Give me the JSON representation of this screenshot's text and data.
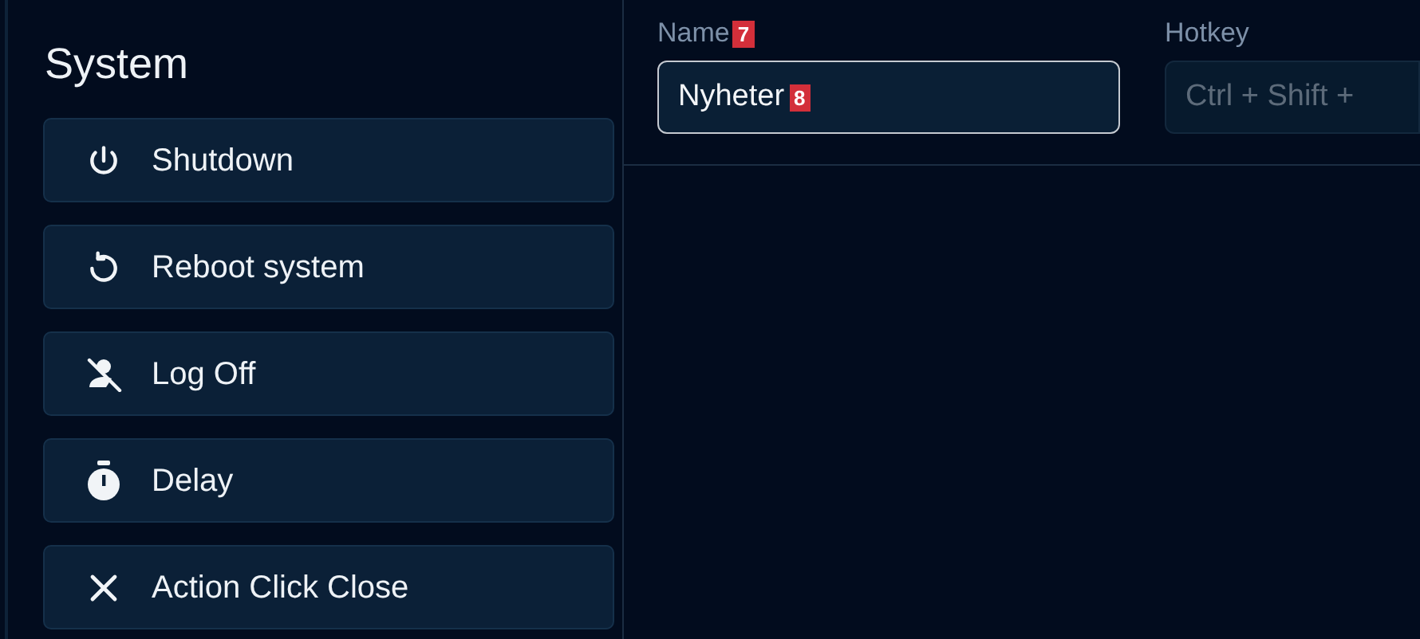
{
  "sidebar": {
    "title": "System",
    "actions": [
      {
        "label": "Shutdown"
      },
      {
        "label": "Reboot system"
      },
      {
        "label": "Log Off"
      },
      {
        "label": "Delay"
      },
      {
        "label": "Action Click Close"
      }
    ]
  },
  "form": {
    "name_field": {
      "label": "Name",
      "label_badge": "7",
      "value": "Nyheter",
      "value_badge": "8"
    },
    "hotkey_field": {
      "label": "Hotkey",
      "placeholder": "Ctrl + Shift +",
      "disabled": true
    }
  }
}
